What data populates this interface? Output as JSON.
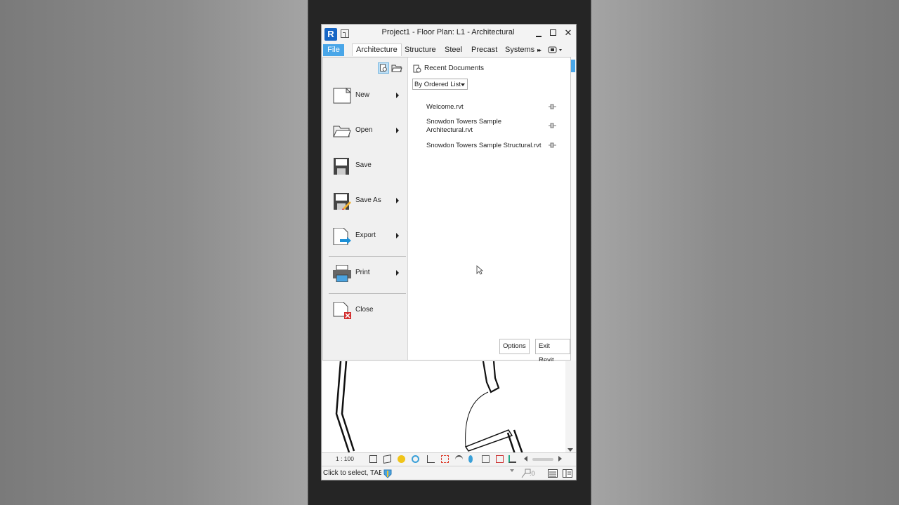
{
  "window": {
    "app_icon_letter": "R",
    "title": "Project1 - Floor Plan: L1 - Architectural",
    "min_label": "",
    "max_label": "",
    "close_label": "✕"
  },
  "ribbon": {
    "tabs": [
      "File",
      "Architecture",
      "Structure",
      "Steel",
      "Precast",
      "Systems"
    ],
    "overflow": "▸▸"
  },
  "file_menu": {
    "items": [
      {
        "label": "New",
        "icon": "new-document-icon",
        "has_submenu": true
      },
      {
        "label": "Open",
        "icon": "open-folder-icon",
        "has_submenu": true
      },
      {
        "label": "Save",
        "icon": "floppy-disk-icon",
        "has_submenu": false
      },
      {
        "label": "Save As",
        "icon": "save-as-icon",
        "has_submenu": true
      },
      {
        "label": "Export",
        "icon": "export-icon",
        "has_submenu": true
      },
      {
        "label": "Print",
        "icon": "printer-icon",
        "has_submenu": true
      },
      {
        "label": "Close",
        "icon": "close-document-icon",
        "has_submenu": false
      }
    ],
    "recent": {
      "title": "Recent Documents",
      "sort": "By Ordered List",
      "documents": [
        "Welcome.rvt",
        "Snowdon Towers Sample Architectural.rvt",
        "Snowdon Towers Sample Structural.rvt"
      ]
    },
    "options_label": "Options",
    "exit_label": "Exit Revit"
  },
  "view_control": {
    "scale": "1 : 100"
  },
  "status": {
    "text": "Click to select, TAB",
    "selection_count": ":0"
  },
  "colors": {
    "accent": "#49a6e8",
    "logo": "#1666c5"
  }
}
